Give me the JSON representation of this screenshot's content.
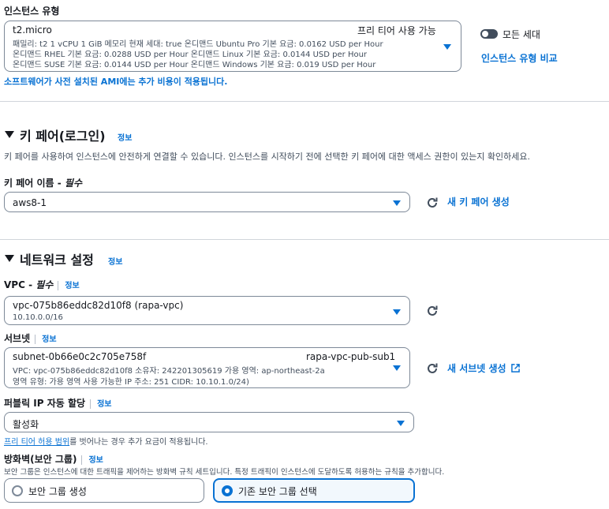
{
  "instance_type": {
    "label": "인스턴스 유형",
    "selected_name": "t2.micro",
    "free_tier_badge": "프리 티어 사용 가능",
    "line1": "패밀리: t2    1 vCPU    1 GiB 메모리    현재 세대: true        온디맨드 Ubuntu Pro 기본 요금: 0.0162 USD per Hour",
    "line2": "온디맨드 RHEL 기본 요금: 0.0288 USD per Hour    온디맨드 Linux 기본 요금: 0.0144 USD per Hour",
    "line3": "온디맨드 SUSE 기본 요금: 0.0144 USD per Hour    온디맨드 Windows 기본 요금: 0.019 USD per Hour",
    "all_gen_label": "모든 세대",
    "compare_link": "인스턴스 유형 비교",
    "ami_note": "소프트웨어가 사전 설치된 AMI에는 추가 비용이 적용됩니다."
  },
  "keypair": {
    "title": "키 페어(로그인)",
    "info": "정보",
    "description": "키 페어를 사용하여 인스턴스에 안전하게 연결할 수 있습니다. 인스턴스를 시작하기 전에 선택한 키 페어에 대한 액세스 권한이 있는지 확인하세요.",
    "name_label": "키 페어 이름 - ",
    "required": "필수",
    "value": "aws8-1",
    "create_link": "새 키 페어 생성"
  },
  "network": {
    "title": "네트워크 설정",
    "info": "정보",
    "vpc_label": "VPC - ",
    "vpc_required": "필수",
    "vpc_info": "정보",
    "vpc_value": "vpc-075b86eddc82d10f8 (rapa-vpc)",
    "vpc_cidr": "10.10.0.0/16",
    "subnet_label": "서브넷",
    "subnet_info": "정보",
    "subnet_id": "subnet-0b66e0c2c705e758f",
    "subnet_name": "rapa-vpc-pub-sub1",
    "subnet_line1": "VPC: vpc-075b86eddc82d10f8    소유자: 242201305619    가용 영역: ap-northeast-2a",
    "subnet_line2": "영역 유형: 가용 영역    사용 가능한 IP 주소: 251    CIDR: 10.10.1.0/24)",
    "create_subnet_link": "새 서브넷 생성",
    "public_ip_label": "퍼블릭 IP 자동 할당",
    "public_ip_info": "정보",
    "public_ip_value": "활성화",
    "free_tier_link": "프리 티어 허용 범위",
    "free_tier_note": "를 벗어나는 경우 추가 요금이 적용됩니다.",
    "firewall_label": "방화벽(보안 그룹)",
    "firewall_info": "정보",
    "firewall_desc": "보안 그룹은 인스턴스에 대한 트래픽을 제어하는 방화벽 규칙 세트입니다. 특정 트래픽이 인스턴스에 도달하도록 허용하는 규칙을 추가합니다.",
    "option_create": "보안 그룹 생성",
    "option_existing": "기존 보안 그룹 선택"
  },
  "colors": {
    "accent": "#0972d3",
    "text": "#16191f",
    "border": "#7d8998"
  },
  "icons": [
    "caret-down-icon",
    "refresh-icon",
    "external-link-icon",
    "toggle-icon",
    "collapse-triangle-icon"
  ]
}
